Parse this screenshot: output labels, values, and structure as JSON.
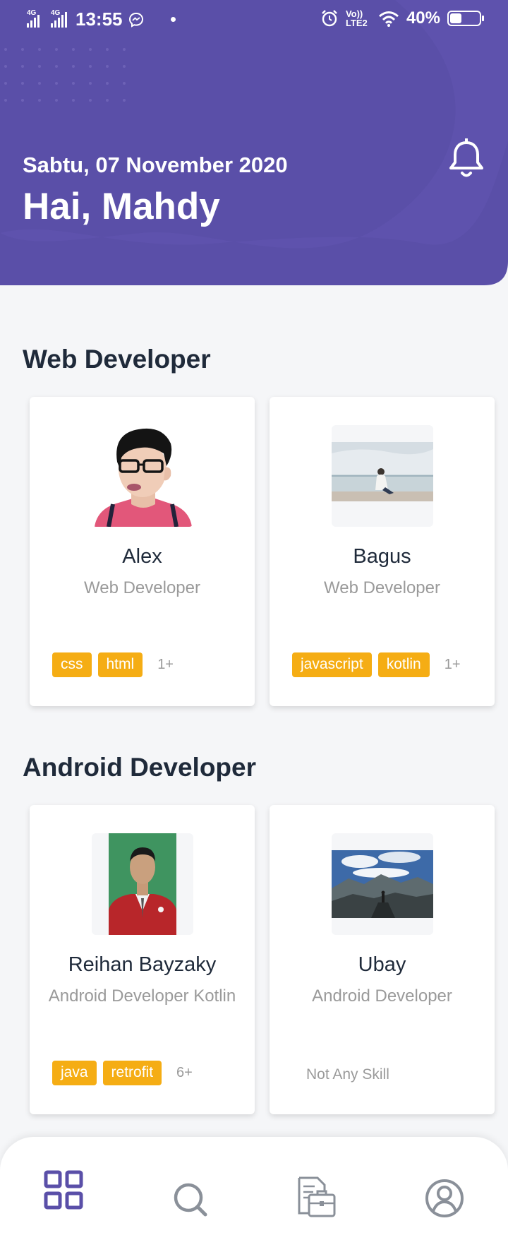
{
  "status_bar": {
    "network_1": "4G",
    "network_2": "4G",
    "time": "13:55",
    "volte_label": "Vo)) LTE2",
    "battery": "40%",
    "battery_level": 0.4,
    "icons": [
      "signal-icon",
      "signal-icon",
      "messenger-icon",
      "notification-dot-icon",
      "alarm-icon",
      "volte-icon",
      "wifi-icon",
      "battery-icon"
    ]
  },
  "header": {
    "date": "Sabtu, 07 November 2020",
    "greeting": "Hai, Mahdy",
    "bell_icon": "bell-icon",
    "background_color": "#5a4fa8"
  },
  "sections": [
    {
      "title": "Web Developer",
      "cards": [
        {
          "name": "Alex",
          "role": "Web Developer",
          "tags": [
            "css",
            "html"
          ],
          "more": "1+",
          "photo": "avatar-illustration"
        },
        {
          "name": "Bagus",
          "role": "Web Developer",
          "tags": [
            "javascript",
            "kotlin"
          ],
          "more": "1+",
          "photo": "beach-photo"
        }
      ]
    },
    {
      "title": "Android Developer",
      "cards": [
        {
          "name": "Reihan Bayzaky",
          "role": "Android Developer Kotlin",
          "tags": [
            "java",
            "retrofit"
          ],
          "more": "6+",
          "photo": "portrait-photo"
        },
        {
          "name": "Ubay",
          "role": "Android Developer",
          "no_skill": "Not Any Skill",
          "photo": "mountain-photo"
        }
      ]
    }
  ],
  "bottom_nav": {
    "items": [
      "grid-icon",
      "search-icon",
      "briefcase-document-icon",
      "profile-icon"
    ],
    "active_color": "#5a4fa8",
    "inactive_color": "#8a9099"
  },
  "colors": {
    "tag": "#f5ad14",
    "title": "#1f2a3a",
    "muted": "#9a9a9a"
  }
}
